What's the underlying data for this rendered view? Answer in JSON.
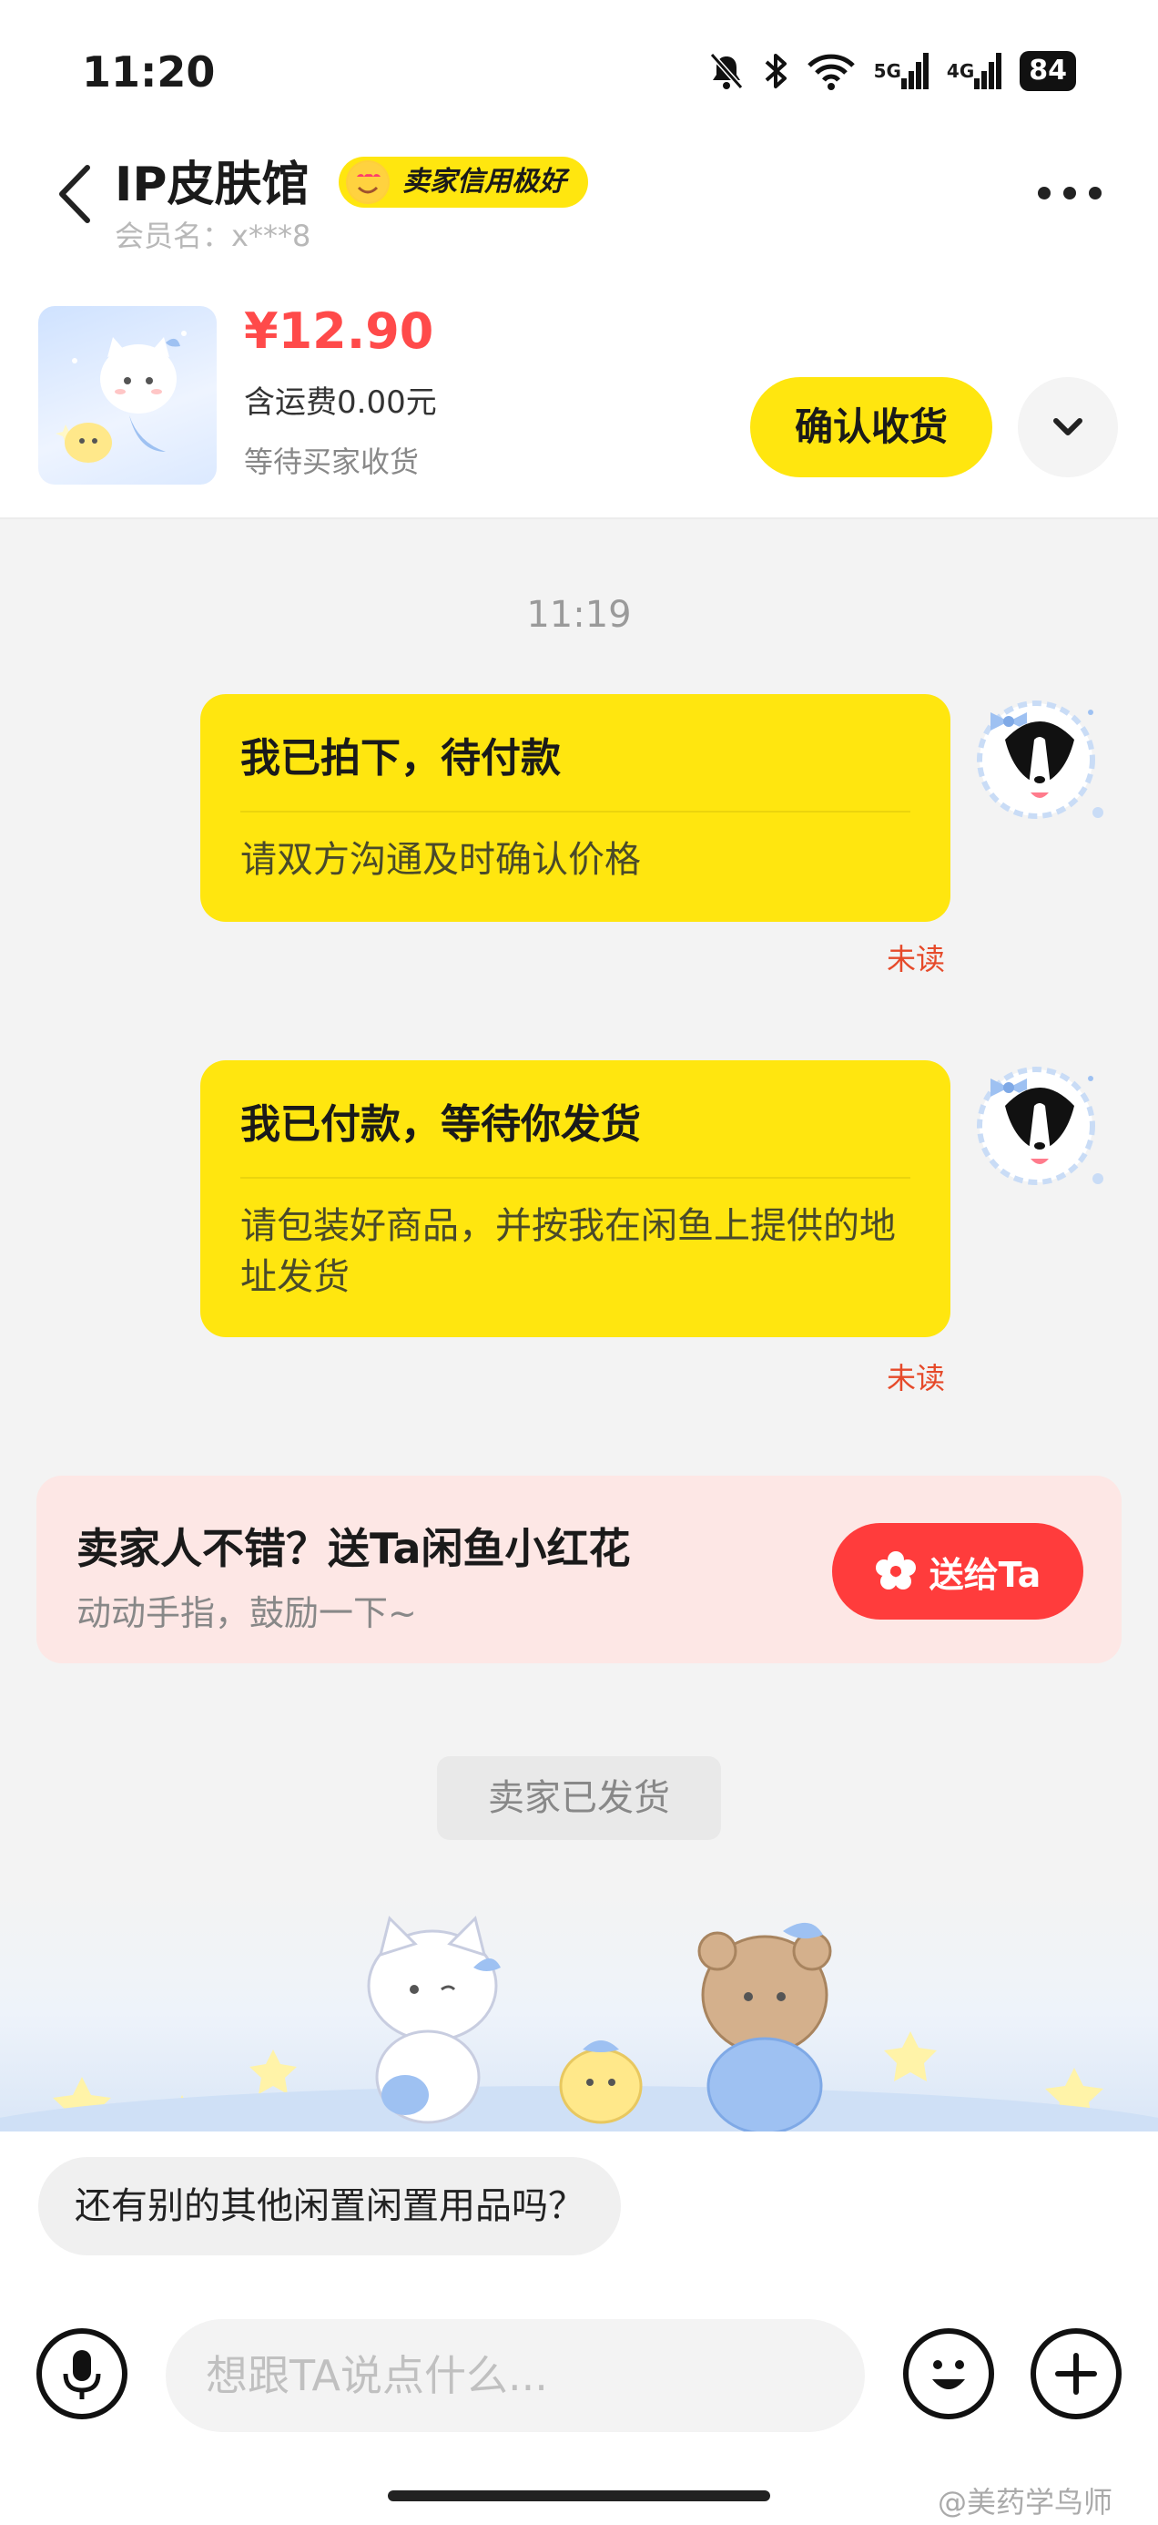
{
  "status_bar": {
    "time": "11:20",
    "net_5g": "5G",
    "net_4g": "4G",
    "battery": "84"
  },
  "header": {
    "shop_name": "IP皮肤馆",
    "credit_badge": "卖家信用极好",
    "member_name": "会员名：x***8"
  },
  "order": {
    "price": "¥12.90",
    "shipping": "含运费0.00元",
    "status": "等待买家收货",
    "confirm_label": "确认收货"
  },
  "chat": {
    "time": "11:19",
    "messages": [
      {
        "title": "我已拍下，待付款",
        "desc": "请双方沟通及时确认价格",
        "status": "未读"
      },
      {
        "title": "我已付款，等待你发货",
        "desc": "请包装好商品，并按我在闲鱼上提供的地址发货",
        "status": "未读"
      }
    ],
    "flower_card": {
      "title": "卖家人不错？送Ta闲鱼小红花",
      "subtitle": "动动手指，鼓励一下~",
      "button": "送给Ta"
    },
    "system_chip": "卖家已发货"
  },
  "input": {
    "suggestion": "还有别的其他闲置闲置用品吗？",
    "placeholder": "想跟TA说点什么..."
  },
  "watermark": "@美药学鸟师",
  "colors": {
    "accent": "#ffe60f",
    "price": "#ff4a4a",
    "send": "#ff3c3c",
    "unread": "#e64a2a"
  }
}
